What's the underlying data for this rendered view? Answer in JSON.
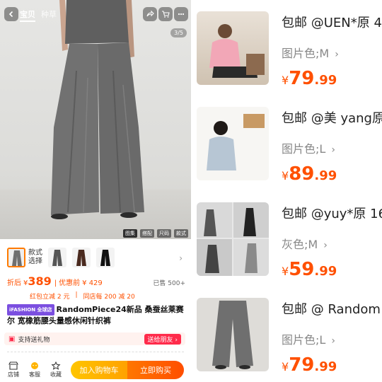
{
  "left": {
    "nav": {
      "tab_active": "宝贝",
      "tab_inactive": "种草"
    },
    "page_indicator": "3/5",
    "media_tabs": [
      "图集",
      "搭配",
      "尺码",
      "款式"
    ],
    "variant_label": "款式\n选择",
    "price": {
      "prefix": "折后",
      "main_yen": "¥",
      "main_value": "389",
      "separator": "|",
      "before_label": "优惠前",
      "before_value": "¥ 429",
      "sold": "已售 500+"
    },
    "coupons": [
      "红包立减 2 元",
      "|",
      "同店每 200 减 20"
    ],
    "badge": "iFASHION 全球店",
    "title": "RandomPiece24新品 桑蚕丝莱赛尔 宽橡筋腰头量感休闲针织裤",
    "gift": {
      "label": "支持送礼物",
      "button": "送给朋友 ›"
    },
    "bottom_bar": {
      "store": "店铺",
      "service": "客服",
      "favorite": "收藏",
      "add_cart": "加入购物车",
      "buy_now": "立即购买"
    }
  },
  "right": {
    "items": [
      {
        "title": "包邮 @UEN*原 4",
        "spec": "图片色;M",
        "yen": "¥",
        "price_int": "79",
        "price_dec": ".99"
      },
      {
        "title": "包邮 @美 yang原",
        "spec": "图片色;L",
        "yen": "¥",
        "price_int": "89",
        "price_dec": ".99"
      },
      {
        "title": "包邮 @yuy*原 16",
        "spec": "灰色;M",
        "yen": "¥",
        "price_int": "59",
        "price_dec": ".99"
      },
      {
        "title": "包邮 @ Random",
        "spec": "图片色;L",
        "yen": "¥",
        "price_int": "79",
        "price_dec": ".99"
      }
    ]
  },
  "colors": {
    "accent_orange": "#ff5000",
    "cart_yellow": "#ffb300",
    "gift_red": "#ff2b4b",
    "pants_grey": "#6f6f6f",
    "badge_purple": "#7b4fe0"
  }
}
